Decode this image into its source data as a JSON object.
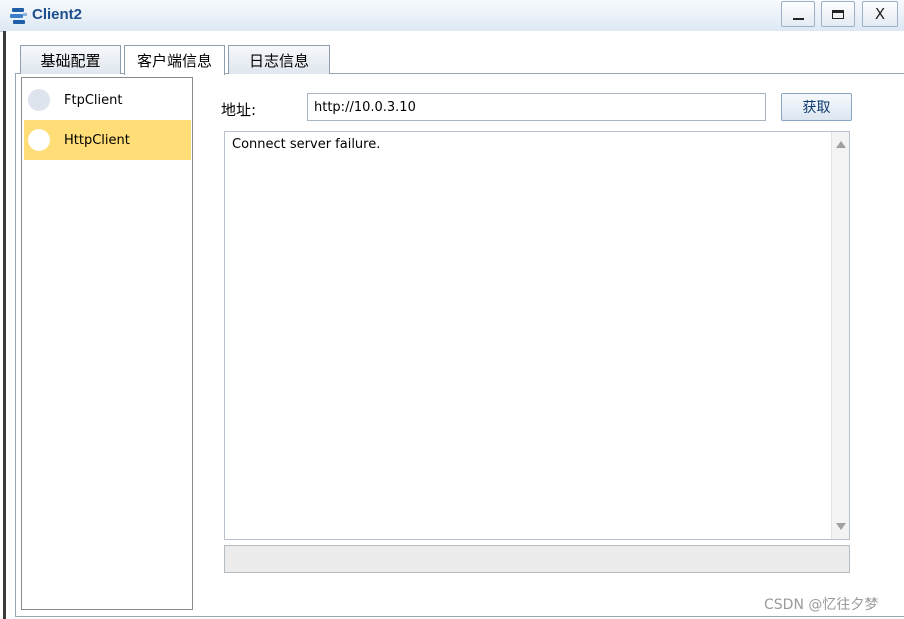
{
  "window": {
    "title": "Client2",
    "close_glyph": "X"
  },
  "tabs": [
    {
      "label": "基础配置",
      "active": false
    },
    {
      "label": "客户端信息",
      "active": true
    },
    {
      "label": "日志信息",
      "active": false
    }
  ],
  "client_list": [
    {
      "label": "FtpClient",
      "selected": false
    },
    {
      "label": "HttpClient",
      "selected": true
    }
  ],
  "address": {
    "label": "地址:",
    "value": "http://10.0.3.10",
    "button_label": "获取"
  },
  "output": {
    "text": "Connect server failure."
  },
  "watermark": "CSDN @忆往夕梦",
  "colors": {
    "selected_item": "#ffdd77",
    "title_text": "#1d4f8c"
  }
}
